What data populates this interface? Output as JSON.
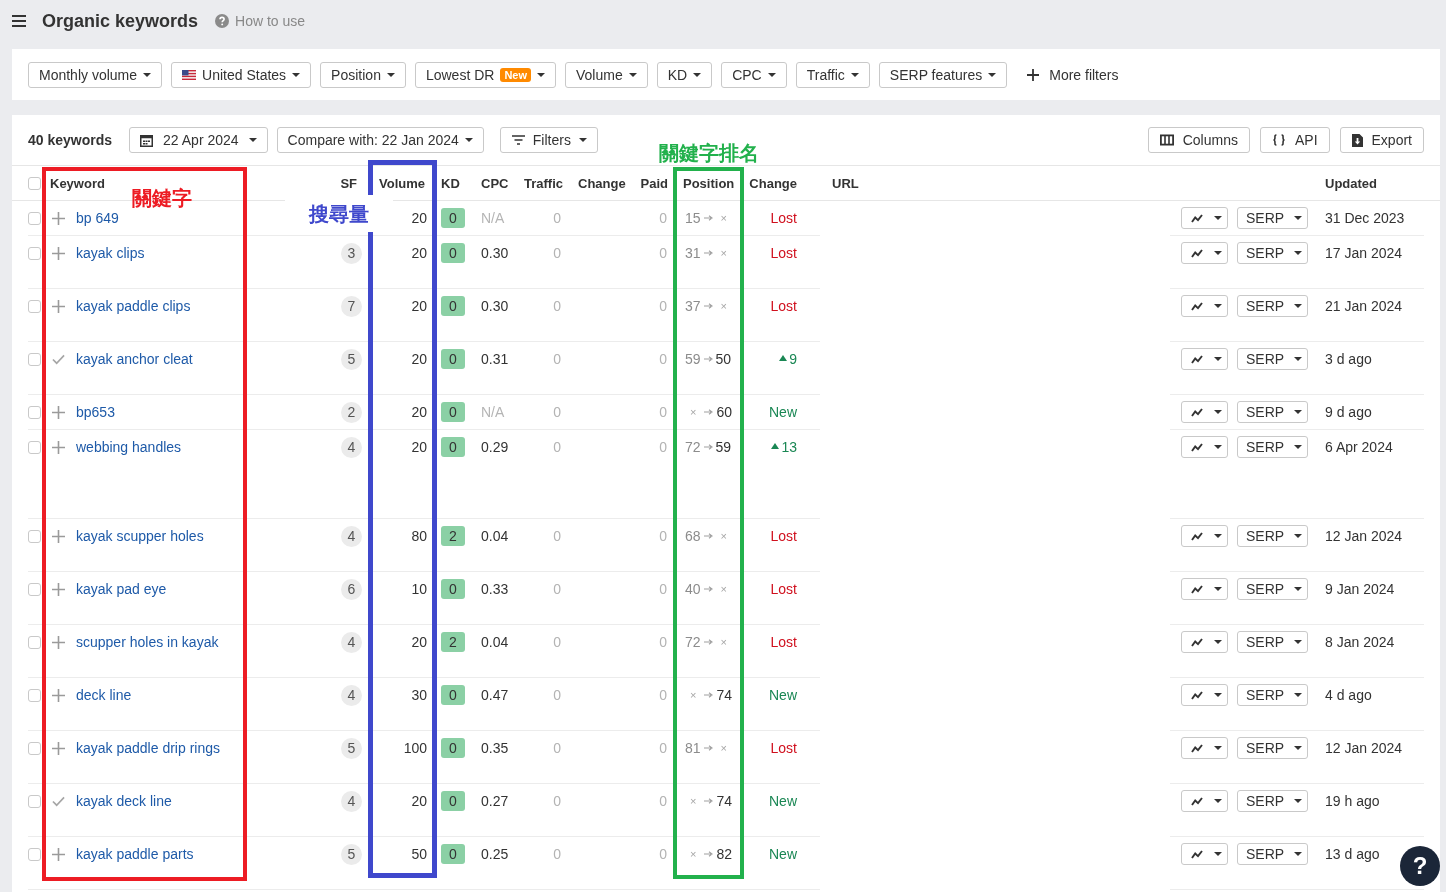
{
  "header": {
    "title": "Organic keywords",
    "help_link": "How to use"
  },
  "filters": [
    {
      "label": "Monthly volume",
      "kind": "dropdown"
    },
    {
      "label": "United States",
      "kind": "country"
    },
    {
      "label": "Position",
      "kind": "dropdown"
    },
    {
      "label": "Lowest DR",
      "kind": "dropdown",
      "badge": "New"
    },
    {
      "label": "Volume",
      "kind": "dropdown"
    },
    {
      "label": "KD",
      "kind": "dropdown"
    },
    {
      "label": "CPC",
      "kind": "dropdown"
    },
    {
      "label": "Traffic",
      "kind": "dropdown"
    },
    {
      "label": "SERP features",
      "kind": "dropdown"
    },
    {
      "label": "More filters",
      "kind": "add"
    }
  ],
  "toolbar": {
    "count": "40 keywords",
    "buttons": [
      {
        "label": "22 Apr 2024",
        "kind": "date"
      },
      {
        "label": "Compare with: 22 Jan 2024",
        "kind": "compare"
      },
      {
        "label": "Filters",
        "kind": "filters"
      }
    ],
    "right_buttons": [
      {
        "label": "Columns",
        "kind": "columns"
      },
      {
        "label": "API",
        "kind": "api"
      },
      {
        "label": "Export",
        "kind": "export"
      }
    ]
  },
  "table": {
    "select_all_checked": false,
    "columns": [
      {
        "label": "Keyword",
        "annotation": {
          "label": "關鍵字",
          "color": "#ed1c24",
          "kind": "inside"
        }
      },
      {
        "label": "SF"
      },
      {
        "label": "Volume",
        "annotation": {
          "label": "搜尋量",
          "color": "#3f48cc",
          "kind": "beside"
        }
      },
      {
        "label": "KD"
      },
      {
        "label": "CPC"
      },
      {
        "label": "Traffic"
      },
      {
        "label": "Change"
      },
      {
        "label": "Paid"
      },
      {
        "label": "Position",
        "annotation": {
          "label": "關鍵字排名",
          "color": "#22b14c",
          "kind": "above"
        }
      },
      {
        "label": "Change"
      },
      {
        "label": "URL"
      },
      {
        "label": "Updated"
      }
    ],
    "rows": [
      {
        "checked": false,
        "added": false,
        "keyword": "bp 649",
        "volume": "20",
        "kd": "0",
        "cpc": "N/A",
        "cpc_missing": true,
        "traffic": "0",
        "paid": "0",
        "position_from": {
          "text": "15",
          "kind": "rank"
        },
        "position_to": {
          "text": "×",
          "kind": "none"
        },
        "change": {
          "text": "Lost",
          "kind": "lost"
        },
        "serp": "SERP",
        "updated": "31 Dec 2023"
      },
      {
        "checked": false,
        "added": false,
        "keyword": "kayak clips",
        "sf": "3",
        "volume": "20",
        "kd": "0",
        "cpc": "0.30",
        "cpc_missing": false,
        "traffic": "0",
        "paid": "0",
        "position_from": {
          "text": "31",
          "kind": "rank"
        },
        "position_to": {
          "text": "×",
          "kind": "none"
        },
        "change": {
          "text": "Lost",
          "kind": "lost"
        },
        "serp": "SERP",
        "updated": "17 Jan 2024"
      },
      {
        "checked": false,
        "added": false,
        "keyword": "kayak paddle clips",
        "sf": "7",
        "volume": "20",
        "kd": "0",
        "cpc": "0.30",
        "cpc_missing": false,
        "traffic": "0",
        "paid": "0",
        "position_from": {
          "text": "37",
          "kind": "rank"
        },
        "position_to": {
          "text": "×",
          "kind": "none"
        },
        "change": {
          "text": "Lost",
          "kind": "lost"
        },
        "serp": "SERP",
        "updated": "21 Jan 2024"
      },
      {
        "checked": false,
        "added": true,
        "keyword": "kayak anchor cleat",
        "sf": "5",
        "volume": "20",
        "kd": "0",
        "cpc": "0.31",
        "cpc_missing": false,
        "traffic": "0",
        "paid": "0",
        "position_from": {
          "text": "59",
          "kind": "rank"
        },
        "position_to": {
          "text": "50",
          "kind": "rank"
        },
        "change": {
          "text": "9",
          "kind": "up"
        },
        "serp": "SERP",
        "updated": "3 d ago"
      },
      {
        "checked": false,
        "added": false,
        "keyword": "bp653",
        "sf": "2",
        "volume": "20",
        "kd": "0",
        "cpc": "N/A",
        "cpc_missing": true,
        "traffic": "0",
        "paid": "0",
        "position_from": {
          "text": "×",
          "kind": "none"
        },
        "position_to": {
          "text": "60",
          "kind": "rank"
        },
        "change": {
          "text": "New",
          "kind": "new"
        },
        "serp": "SERP",
        "updated": "9 d ago"
      },
      {
        "checked": false,
        "added": false,
        "keyword": "webbing handles",
        "sf": "4",
        "volume": "20",
        "kd": "0",
        "cpc": "0.29",
        "cpc_missing": false,
        "traffic": "0",
        "paid": "0",
        "position_from": {
          "text": "72",
          "kind": "rank"
        },
        "position_to": {
          "text": "59",
          "kind": "rank"
        },
        "change": {
          "text": "13",
          "kind": "up"
        },
        "serp": "SERP",
        "updated": "6 Apr 2024"
      },
      {
        "checked": false,
        "added": false,
        "keyword": "kayak scupper holes",
        "sf": "4",
        "volume": "80",
        "kd": "2",
        "cpc": "0.04",
        "cpc_missing": false,
        "traffic": "0",
        "paid": "0",
        "position_from": {
          "text": "68",
          "kind": "rank"
        },
        "position_to": {
          "text": "×",
          "kind": "none"
        },
        "change": {
          "text": "Lost",
          "kind": "lost"
        },
        "serp": "SERP",
        "updated": "12 Jan 2024"
      },
      {
        "checked": false,
        "added": false,
        "keyword": "kayak pad eye",
        "sf": "6",
        "volume": "10",
        "kd": "0",
        "cpc": "0.33",
        "cpc_missing": false,
        "traffic": "0",
        "paid": "0",
        "position_from": {
          "text": "40",
          "kind": "rank"
        },
        "position_to": {
          "text": "×",
          "kind": "none"
        },
        "change": {
          "text": "Lost",
          "kind": "lost"
        },
        "serp": "SERP",
        "updated": "9 Jan 2024"
      },
      {
        "checked": false,
        "added": false,
        "keyword": "scupper holes in kayak",
        "sf": "4",
        "volume": "20",
        "kd": "2",
        "cpc": "0.04",
        "cpc_missing": false,
        "traffic": "0",
        "paid": "0",
        "position_from": {
          "text": "72",
          "kind": "rank"
        },
        "position_to": {
          "text": "×",
          "kind": "none"
        },
        "change": {
          "text": "Lost",
          "kind": "lost"
        },
        "serp": "SERP",
        "updated": "8 Jan 2024"
      },
      {
        "checked": false,
        "added": false,
        "keyword": "deck line",
        "sf": "4",
        "volume": "30",
        "kd": "0",
        "cpc": "0.47",
        "cpc_missing": false,
        "traffic": "0",
        "paid": "0",
        "position_from": {
          "text": "×",
          "kind": "none"
        },
        "position_to": {
          "text": "74",
          "kind": "rank"
        },
        "change": {
          "text": "New",
          "kind": "new"
        },
        "serp": "SERP",
        "updated": "4 d ago"
      },
      {
        "checked": false,
        "added": false,
        "keyword": "kayak paddle drip rings",
        "sf": "5",
        "volume": "100",
        "kd": "0",
        "cpc": "0.35",
        "cpc_missing": false,
        "traffic": "0",
        "paid": "0",
        "position_from": {
          "text": "81",
          "kind": "rank"
        },
        "position_to": {
          "text": "×",
          "kind": "none"
        },
        "change": {
          "text": "Lost",
          "kind": "lost"
        },
        "serp": "SERP",
        "updated": "12 Jan 2024"
      },
      {
        "checked": false,
        "added": true,
        "keyword": "kayak deck line",
        "sf": "4",
        "volume": "20",
        "kd": "0",
        "cpc": "0.27",
        "cpc_missing": false,
        "traffic": "0",
        "paid": "0",
        "position_from": {
          "text": "×",
          "kind": "none"
        },
        "position_to": {
          "text": "74",
          "kind": "rank"
        },
        "change": {
          "text": "New",
          "kind": "new"
        },
        "serp": "SERP",
        "updated": "19 h ago"
      },
      {
        "checked": false,
        "added": false,
        "keyword": "kayak paddle parts",
        "sf": "5",
        "volume": "50",
        "kd": "0",
        "cpc": "0.25",
        "cpc_missing": false,
        "traffic": "0",
        "paid": "0",
        "position_from": {
          "text": "×",
          "kind": "none"
        },
        "position_to": {
          "text": "82",
          "kind": "rank"
        },
        "change": {
          "text": "New",
          "kind": "new"
        },
        "serp": "SERP",
        "updated": "13 d ago"
      }
    ]
  },
  "help_button": "?"
}
